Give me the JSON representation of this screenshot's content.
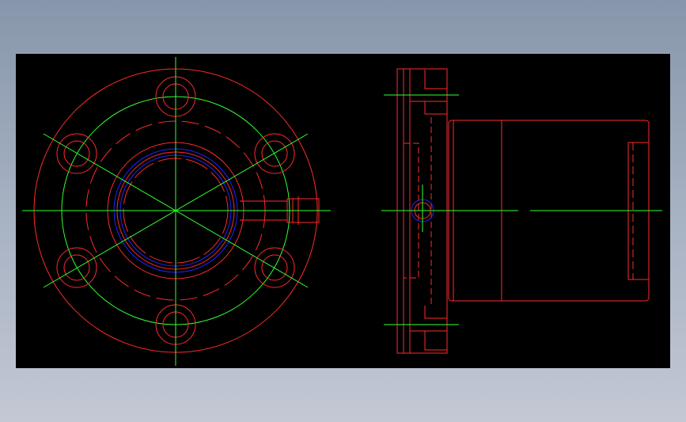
{
  "drawing": {
    "background": "#000000",
    "page_background_top": "#8796ab",
    "page_background_bottom": "#c3c8d4",
    "colors": {
      "outline": "#ff2a2a",
      "centerline": "#33ff33",
      "hidden": "#ff2a2a",
      "seal": "#2222ff"
    },
    "views": [
      {
        "name": "front-view",
        "description_icon": "flange-circle-icon"
      },
      {
        "name": "side-view",
        "description_icon": "flange-side-icon"
      }
    ],
    "bolt_holes": 6
  }
}
